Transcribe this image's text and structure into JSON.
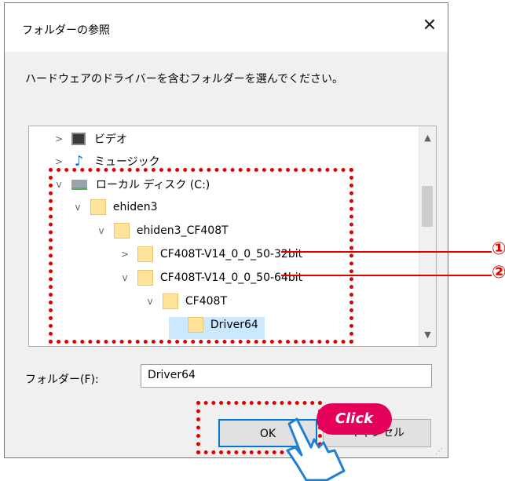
{
  "dialog": {
    "title": "フォルダーの参照",
    "close_glyph": "✕",
    "prompt": "ハードウェアのドライバーを含むフォルダーを選んでください。",
    "tree": {
      "items": [
        {
          "label": "ビデオ",
          "icon": "video-icon",
          "expander": ">"
        },
        {
          "label": "ミュージック",
          "icon": "music-icon",
          "expander": ">"
        },
        {
          "label": "ローカル ディスク (C:)",
          "icon": "drive-icon",
          "expander": "v"
        },
        {
          "label": "ehiden3",
          "icon": "folder-icon",
          "expander": "v"
        },
        {
          "label": "ehiden3_CF408T",
          "icon": "folder-icon",
          "expander": "v"
        },
        {
          "label": "CF408T-V14_0_0_50-32bit",
          "icon": "folder-icon",
          "expander": ">"
        },
        {
          "label": "CF408T-V14_0_0_50-64bit",
          "icon": "folder-icon",
          "expander": "v"
        },
        {
          "label": "CF408T",
          "icon": "folder-icon",
          "expander": "v"
        },
        {
          "label": "Driver64",
          "icon": "folder-icon",
          "expander": "",
          "selected": true
        }
      ]
    },
    "folder_label": "フォルダー(F):",
    "folder_value": "Driver64",
    "ok_label": "OK",
    "cancel_label": "キャンセル"
  },
  "annotations": {
    "marker_1": "①",
    "marker_2": "②",
    "click_badge": "Click",
    "accent_color": "#e00000"
  }
}
